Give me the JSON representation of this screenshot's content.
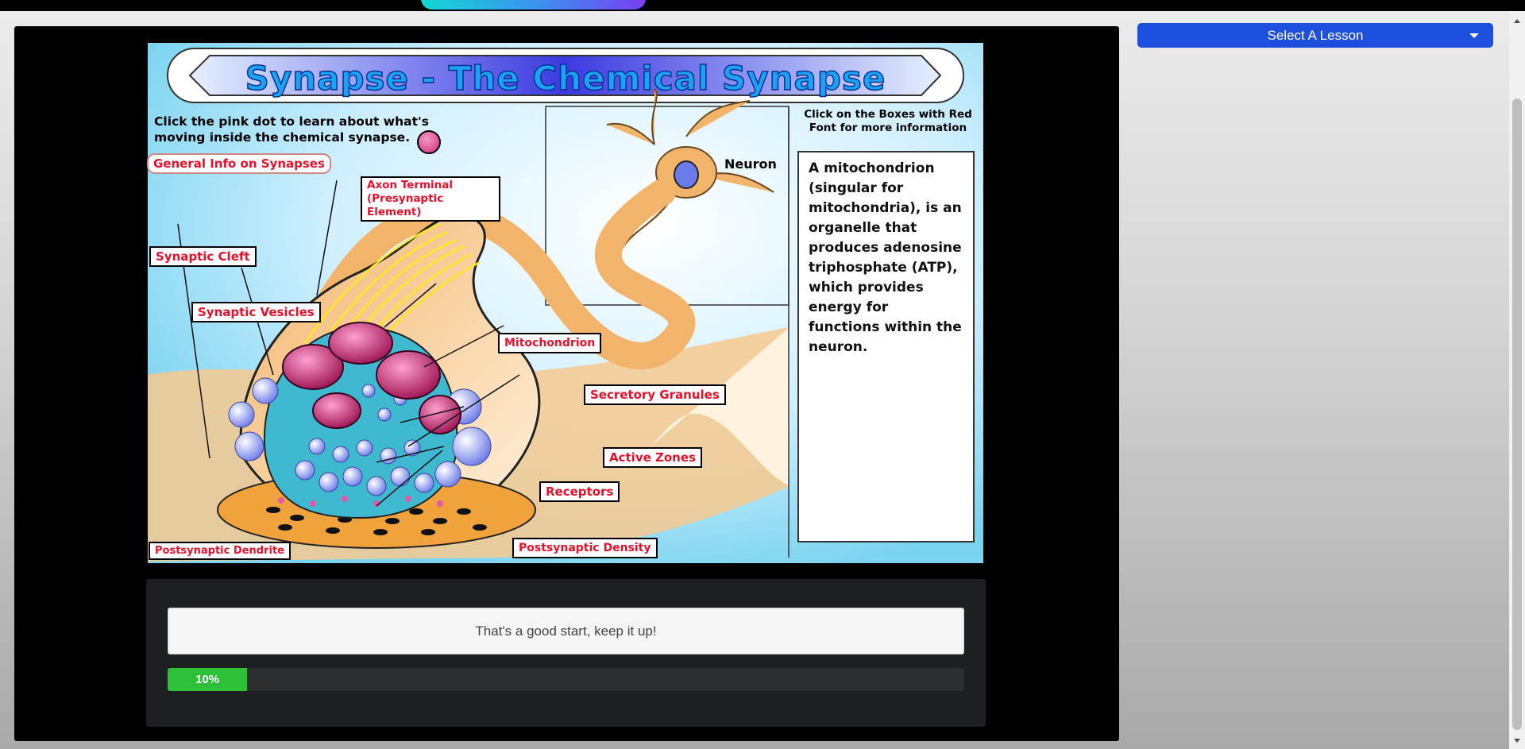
{
  "lesson_select": {
    "label": "Select A Lesson"
  },
  "diagram": {
    "title": "Synapse - The Chemical Synapse",
    "instruction": "Click the pink dot to learn about what's moving inside the chemical synapse.",
    "general_info": "General Info on Synapses",
    "side_hint": "Click on the Boxes with Red Font for more information",
    "neuron_label": "Neuron",
    "info_text": "A mitochondrion (singular for mitochondria), is an organelle that produces adenosine triphosphate (ATP), which provides energy for functions within the neuron.",
    "labels": {
      "axon_terminal": "Axon Terminal (Presynaptic Element)",
      "synaptic_cleft": "Synaptic Cleft",
      "synaptic_vesicles": "Synaptic Vesicles",
      "mitochondrion": "Mitochondrion",
      "secretory_granules": "Secretory Granules",
      "active_zones": "Active Zones",
      "receptors": "Receptors",
      "postsynaptic_density": "Postsynaptic Density",
      "postsynaptic_dendrite": "Postsynaptic Dendrite"
    }
  },
  "feedback": {
    "message": "That's a good start, keep it up!"
  },
  "progress": {
    "value": 0.1,
    "label": "10%"
  },
  "colors": {
    "accent": "#1d4fde",
    "progress": "#2fc03a",
    "label_red": "#e8102a"
  }
}
